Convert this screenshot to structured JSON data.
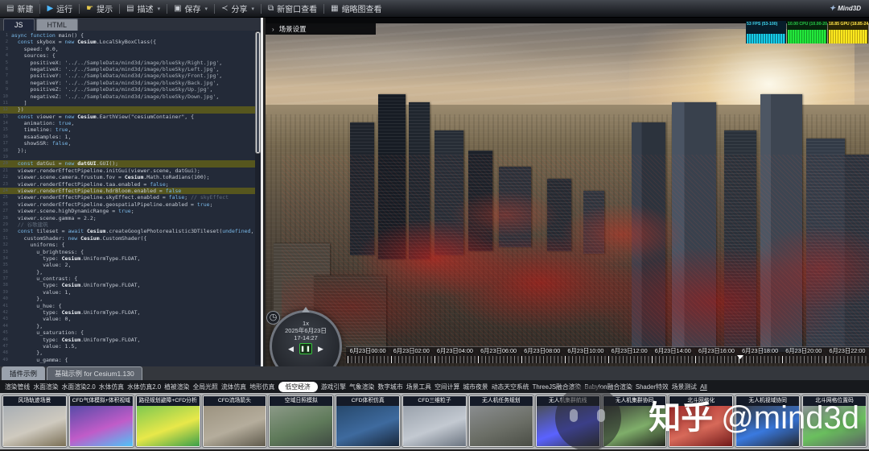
{
  "toolbar": {
    "items": [
      {
        "id": "new",
        "label": "新建",
        "glyph": "▤",
        "dropdown": false
      },
      {
        "id": "run",
        "label": "运行",
        "glyph": "▶",
        "dropdown": false
      },
      {
        "id": "hint",
        "label": "提示",
        "glyph": "☛",
        "dropdown": false
      },
      {
        "id": "describe",
        "label": "描述",
        "glyph": "▤",
        "dropdown": true
      },
      {
        "id": "save",
        "label": "保存",
        "glyph": "▣",
        "dropdown": true
      },
      {
        "id": "share",
        "label": "分享",
        "glyph": "≺",
        "dropdown": true
      },
      {
        "id": "new-window",
        "label": "新窗口查看",
        "glyph": "⧉",
        "dropdown": false
      },
      {
        "id": "thumbnail-view",
        "label": "缩略图查看",
        "glyph": "▦",
        "dropdown": false
      }
    ],
    "logo": "Mind3D"
  },
  "editor": {
    "tabs": [
      {
        "label": "JS",
        "active": true
      },
      {
        "label": "HTML",
        "active": false
      }
    ],
    "highlighted_lines": [
      12,
      20,
      24
    ],
    "lines": [
      "async function main() {",
      "  const skybox = new Cesium.LocalSkyBoxClass({",
      "    speed: 0.0,",
      "    sources: {",
      "      positiveX: '../../SampleData/mind3d/image/blueSky/Right.jpg',",
      "      negativeX: '../../SampleData/mind3d/image/blueSky/Left.jpg',",
      "      positiveY: '../../SampleData/mind3d/image/blueSky/Front.jpg',",
      "      negativeY: '../../SampleData/mind3d/image/blueSky/Back.jpg',",
      "      positiveZ: '../../SampleData/mind3d/image/blueSky/Up.jpg',",
      "      negativeZ: '../../SampleData/mind3d/image/blueSky/Down.jpg',",
      "    ]",
      "  })",
      "  const viewer = new Cesium.EarthView(\"cesiumContainer\", {",
      "    animation: true,",
      "    timeline: true,",
      "    msaaSamples: 1,",
      "    showSSR: false,",
      "  });",
      "",
      "  const datGui = new datGUI.GUI();",
      "  viewer.renderEffectPipeline.initGui(viewer.scene, datGui);",
      "  viewer.scene.camera.frustum.fov = Cesium.Math.toRadians(100);",
      "  viewer.renderEffectPipeline.taa.enabled = false;",
      "  viewer.renderEffectPipeline.hdrBloom.enabled = false",
      "  viewer.renderEffectPipeline.skyEffect.enabled = false; // skyEffect",
      "  viewer.renderEffectPipeline.geospatialPipeline.enabled = true;",
      "  viewer.scene.highDynamicRange = true;",
      "  viewer.scene.gamma = 2.2;",
      "  // 谷歌建筑",
      "  const tileset = await Cesium.createGooglePhotorealistic3DTileset(undefined,",
      "    customShader: new Cesium.CustomShader({",
      "      uniforms: {",
      "        u_brightness: {",
      "          type: Cesium.UniformType.FLOAT,",
      "          value: 2,",
      "        },",
      "        u_contrast: {",
      "          type: Cesium.UniformType.FLOAT,",
      "          value: 1,",
      "        },",
      "        u_hue: {",
      "          type: Cesium.UniformType.FLOAT,",
      "          value: 0,",
      "        },",
      "        u_saturation: {",
      "          type: Cesium.UniformType.FLOAT,",
      "          value: 1.5,",
      "        },",
      "        u_gamma: {"
    ]
  },
  "viewport": {
    "scene_settings_label": "场景设置",
    "heat_overlay_color": "#b91e1e",
    "stats": [
      {
        "label": "53 FPS (53-100)",
        "color": "#17cce8"
      },
      {
        "label": "10.00 CPU (10.00-20)",
        "color": "#23e83c"
      },
      {
        "label": "18.85 GPU (18.85-24)",
        "color": "#ffe81e"
      }
    ],
    "animation": {
      "speed": "1x",
      "date": "2025年6月23日",
      "time": "17-14:27",
      "pause_glyph": "❚❚",
      "back_glyph": "◀",
      "fwd_glyph": "▶"
    },
    "timeline_ticks": [
      "6月23日00:00",
      "6月23日02:00",
      "6月23日04:00",
      "6月23日06:00",
      "6月23日08:00",
      "6月23日10:00",
      "6月23日12:00",
      "6月23日14:00",
      "6月23日16:00",
      "6月23日18:00",
      "6月23日20:00",
      "6月23日22:00"
    ]
  },
  "bottom": {
    "panel_tabs": [
      {
        "label": "插件示例",
        "active": true
      },
      {
        "label": "基础示例 for Cesium1.130",
        "active": false
      }
    ],
    "categories": [
      "渲染管线",
      "水面渲染",
      "水面渲染2.0",
      "水体仿真",
      "水体仿真2.0",
      "植被渲染",
      "全局光照",
      "流体仿真",
      "地形仿真",
      "低空经济",
      "游戏引擎",
      "气象渲染",
      "数字城市",
      "场景工具",
      "空间计算",
      "城市夜景",
      "动态天空系统",
      "ThreeJS融合渲染",
      "Babylon融合渲染",
      "Shader特效",
      "场景测试",
      "All"
    ],
    "selected_category": "低空经济",
    "thumbnails": [
      {
        "title": "风场轨迹场景",
        "colors": [
          "#a8aeb4",
          "#cfcabf",
          "#7a6f55"
        ]
      },
      {
        "title": "CFD气体模拟+体积视域",
        "colors": [
          "#584ba8",
          "#c05cc8",
          "#4fc3f7"
        ]
      },
      {
        "title": "路径规划避障+CFD分析",
        "colors": [
          "#7ec850",
          "#e8e84a",
          "#3a9e4a"
        ]
      },
      {
        "title": "CFD流场箭头",
        "colors": [
          "#9c9380",
          "#b5ad9c",
          "#5f5a4c"
        ]
      },
      {
        "title": "空域日照模拟",
        "colors": [
          "#8c9a88",
          "#5f7a5a",
          "#3f4a42"
        ]
      },
      {
        "title": "CFD体积仿真",
        "colors": [
          "#27496d",
          "#3e6a9e",
          "#18263a"
        ]
      },
      {
        "title": "CFD三维粒子",
        "colors": [
          "#9aa2ac",
          "#c3c9d1",
          "#6b7480"
        ]
      },
      {
        "title": "无人机任务规划",
        "colors": [
          "#8a8d8f",
          "#6b6e66",
          "#4a4d45"
        ]
      },
      {
        "title": "无人机集群航线",
        "colors": [
          "#4a4f58",
          "#5a62ff",
          "#30343c"
        ]
      },
      {
        "title": "无人机集群协同",
        "colors": [
          "#3c4038",
          "#7fae6a",
          "#23251f"
        ]
      },
      {
        "title": "北斗网格化",
        "colors": [
          "#b03030",
          "#d86a5a",
          "#701818"
        ]
      },
      {
        "title": "无人机视域协同",
        "colors": [
          "#3a3f48",
          "#3a7ae0",
          "#23262c"
        ]
      },
      {
        "title": "北斗网格位置码",
        "colors": [
          "#8f9699",
          "#6abf5e",
          "#5a5f62"
        ]
      }
    ]
  },
  "watermark": {
    "brand": "知乎",
    "handle": "@mind3d"
  }
}
